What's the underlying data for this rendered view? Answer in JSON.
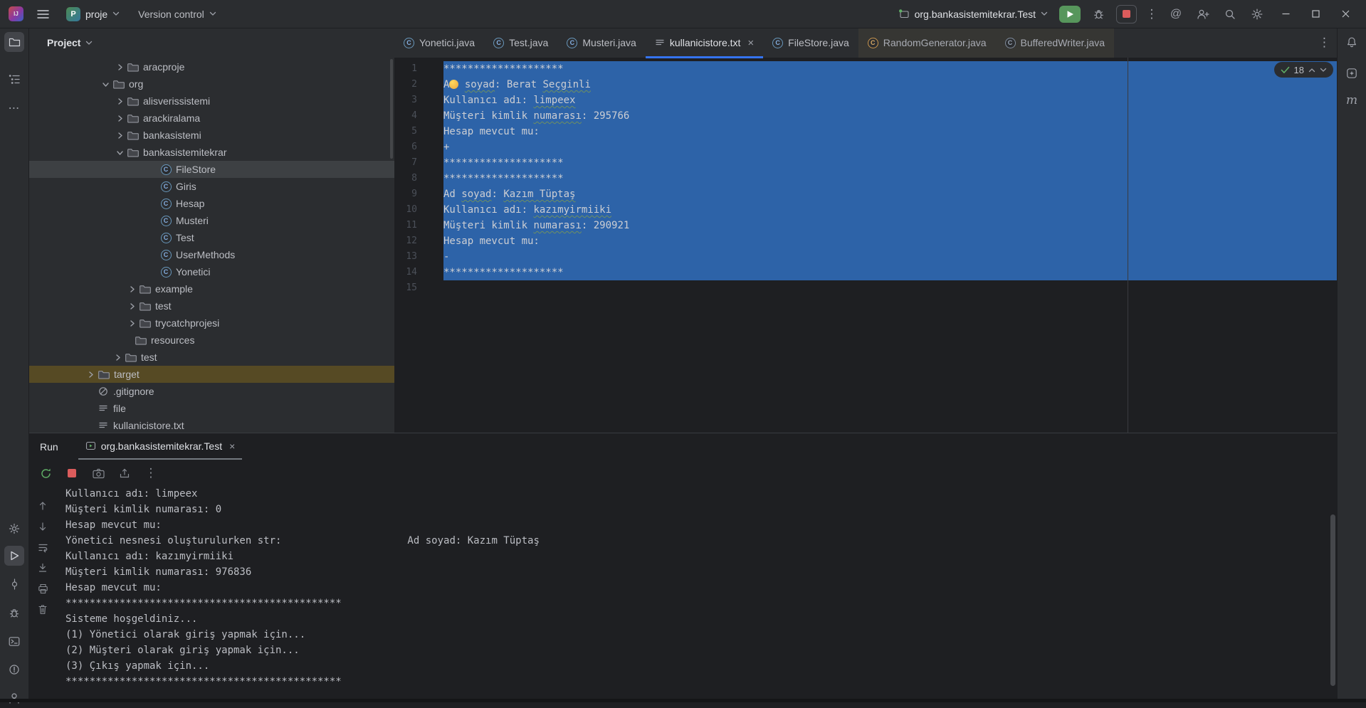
{
  "titlebar": {
    "project": "proje",
    "menu": "Version control",
    "run_config": "org.bankasistemitekrar.Test"
  },
  "tabs": [
    {
      "label": "Yonetici.java",
      "type": "class"
    },
    {
      "label": "Test.java",
      "type": "class"
    },
    {
      "label": "Musteri.java",
      "type": "class"
    },
    {
      "label": "kullanicistore.txt",
      "type": "text",
      "active": true,
      "closable": true
    },
    {
      "label": "FileStore.java",
      "type": "class"
    },
    {
      "label": "RandomGenerator.java",
      "type": "class-lib",
      "lib": true
    },
    {
      "label": "BufferedWriter.java",
      "type": "class-lib2",
      "lib": true
    }
  ],
  "project_panel": {
    "title": "Project",
    "items": [
      {
        "label": "aracproje",
        "chev": "right",
        "icon": "folder",
        "pad": 119
      },
      {
        "label": "org",
        "chev": "down",
        "icon": "folder",
        "pad": 99
      },
      {
        "label": "alisverissistemi",
        "chev": "right",
        "icon": "folder",
        "pad": 119
      },
      {
        "label": "arackiralama",
        "chev": "right",
        "icon": "folder",
        "pad": 119
      },
      {
        "label": "bankasistemi",
        "chev": "right",
        "icon": "folder",
        "pad": 119
      },
      {
        "label": "bankasistemitekrar",
        "chev": "down",
        "icon": "folder",
        "pad": 119
      },
      {
        "label": "FileStore",
        "icon": "class",
        "pad": 165,
        "sel": "gray"
      },
      {
        "label": "Giris",
        "icon": "class",
        "pad": 165
      },
      {
        "label": "Hesap",
        "icon": "class",
        "pad": 165
      },
      {
        "label": "Musteri",
        "icon": "class",
        "pad": 165
      },
      {
        "label": "Test",
        "icon": "class",
        "pad": 165
      },
      {
        "label": "UserMethods",
        "icon": "class",
        "pad": 165
      },
      {
        "label": "Yonetici",
        "icon": "class",
        "pad": 165
      },
      {
        "label": "example",
        "chev": "right",
        "icon": "folder",
        "pad": 136
      },
      {
        "label": "test",
        "chev": "right",
        "icon": "folder",
        "pad": 136
      },
      {
        "label": "trycatchprojesi",
        "chev": "right",
        "icon": "folder",
        "pad": 136
      },
      {
        "label": "resources",
        "icon": "folder",
        "pad": 130
      },
      {
        "label": "test",
        "chev": "right",
        "icon": "folder",
        "pad": 116
      },
      {
        "label": "target",
        "chev": "right",
        "icon": "folder",
        "pad": 78,
        "sel": "orange"
      },
      {
        "label": ".gitignore",
        "icon": "ignore",
        "pad": 77
      },
      {
        "label": "file",
        "icon": "text",
        "pad": 77
      },
      {
        "label": "kullanicistore.txt",
        "icon": "text",
        "pad": 77
      }
    ]
  },
  "editor": {
    "inspection_count": "18",
    "lines": [
      {
        "n": "1",
        "segs": [
          {
            "t": "********************"
          }
        ]
      },
      {
        "n": "2",
        "segs": [
          {
            "t": "A"
          },
          {
            "dot": true
          },
          {
            "t": " "
          },
          {
            "t": "soyad",
            "typo": true
          },
          {
            "t": ": Berat "
          },
          {
            "t": "Seçginli",
            "typo": true
          }
        ]
      },
      {
        "n": "3",
        "segs": [
          {
            "t": "Kullanıcı adı: "
          },
          {
            "t": "limpeex",
            "typo": true
          }
        ]
      },
      {
        "n": "4",
        "segs": [
          {
            "t": "Müşteri kimlik "
          },
          {
            "t": "numarası",
            "typo": true
          },
          {
            "t": ": 295766"
          }
        ]
      },
      {
        "n": "5",
        "segs": [
          {
            "t": "Hesap mevcut mu:"
          }
        ]
      },
      {
        "n": "6",
        "segs": [
          {
            "t": "+"
          }
        ]
      },
      {
        "n": "7",
        "segs": [
          {
            "t": "********************"
          }
        ]
      },
      {
        "n": "8",
        "segs": [
          {
            "t": "********************"
          }
        ]
      },
      {
        "n": "9",
        "segs": [
          {
            "t": "Ad "
          },
          {
            "t": "soyad",
            "typo": true
          },
          {
            "t": ": "
          },
          {
            "t": "Kazım Tüptaş",
            "typo": true
          }
        ]
      },
      {
        "n": "10",
        "segs": [
          {
            "t": "Kullanıcı adı: "
          },
          {
            "t": "kazımyirmiiki",
            "typo": true
          }
        ]
      },
      {
        "n": "11",
        "segs": [
          {
            "t": "Müşteri kimlik "
          },
          {
            "t": "numarası",
            "typo": true
          },
          {
            "t": ": 290921"
          }
        ]
      },
      {
        "n": "12",
        "segs": [
          {
            "t": "Hesap mevcut mu:"
          }
        ]
      },
      {
        "n": "13",
        "segs": [
          {
            "t": "-"
          }
        ]
      },
      {
        "n": "14",
        "segs": [
          {
            "t": "********************"
          }
        ]
      },
      {
        "n": "15",
        "segs": []
      }
    ]
  },
  "run_panel": {
    "label": "Run",
    "tab": "org.bankasistemitekrar.Test",
    "console_lines": [
      "Kullanıcı adı: limpeex",
      "Müşteri kimlik numarası: 0",
      "Hesap mevcut mu:",
      "Yönetici nesnesi oluşturulurken str:                     Ad soyad: Kazım Tüptaş",
      "Kullanıcı adı: kazımyirmiiki",
      "Müşteri kimlik numarası: 976836",
      "Hesap mevcut mu:",
      "**********************************************",
      "Sisteme hoşgeldiniz...",
      "(1) Yönetici olarak giriş yapmak için...",
      "(2) Müşteri olarak giriş yapmak için...",
      "(3) Çıkış yapmak için...",
      "**********************************************"
    ]
  },
  "colors": {
    "accent_blue": "#3574f0",
    "selection_blue": "#2d63a8",
    "run_green": "#57965c",
    "stop_red": "#db5c5c",
    "target_row": "#564a24",
    "tree_selection": "#3d4043",
    "emoji_yellow": "#f2c14b"
  }
}
